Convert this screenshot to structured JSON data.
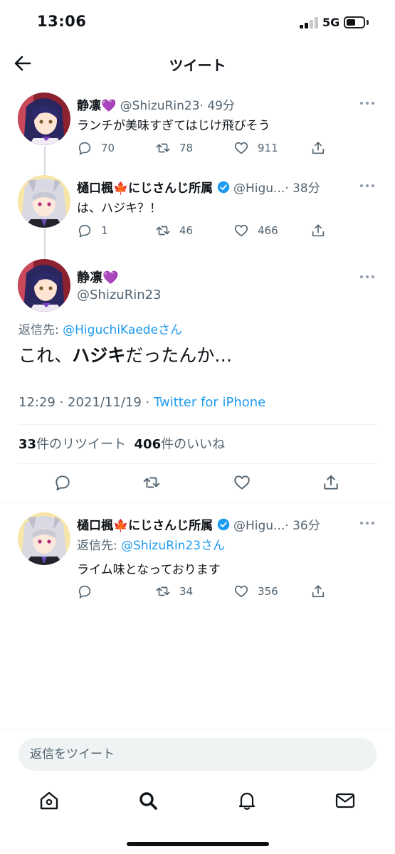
{
  "status_bar": {
    "time": "13:06",
    "network": "5G",
    "signal_bars": 2,
    "battery_level": 0.45
  },
  "header": {
    "title": "ツイート"
  },
  "tweets": [
    {
      "name": "静凛💜",
      "handle": "@ShizuRin23",
      "time": "· 49分",
      "text": "ランチが美味すぎてはじけ飛びそう",
      "replies": "70",
      "retweets": "78",
      "likes": "911"
    },
    {
      "name": "樋口楓🍁にじさんじ所属",
      "handle": "@Higu...",
      "time": "· 38分",
      "text": "は、ハジキ？！",
      "replies": "1",
      "retweets": "46",
      "likes": "466"
    }
  ],
  "main_tweet": {
    "name": "静凛💜",
    "handle": "@ShizuRin23",
    "reply_prefix": "返信先: ",
    "reply_handle": "@HiguchiKaedeさん",
    "text_before": "これ、",
    "text_bold": "ハジキ",
    "text_after": "だったんか…",
    "timestamp": "12:29 · 2021/11/19 · ",
    "source": "Twitter for iPhone",
    "retweet_count": "33",
    "retweet_label": "件のリツイート",
    "like_count": "406",
    "like_label": "件のいいね"
  },
  "reply_tweet": {
    "name": "樋口楓🍁にじさんじ所属",
    "handle": "@Higu...",
    "time": "· 36分",
    "reply_prefix": "返信先: ",
    "reply_handle": "@ShizuRin23さん",
    "text": "ライム味となっております",
    "retweets": "34",
    "likes": "356"
  },
  "reply_bar": {
    "placeholder": "返信をツイート"
  },
  "tabs": [
    "home-icon",
    "search-icon",
    "bell-icon",
    "mail-icon"
  ],
  "colors": {
    "link": "#1d9bf0",
    "secondary_text": "#536471",
    "verified": "#1d9bf0"
  }
}
